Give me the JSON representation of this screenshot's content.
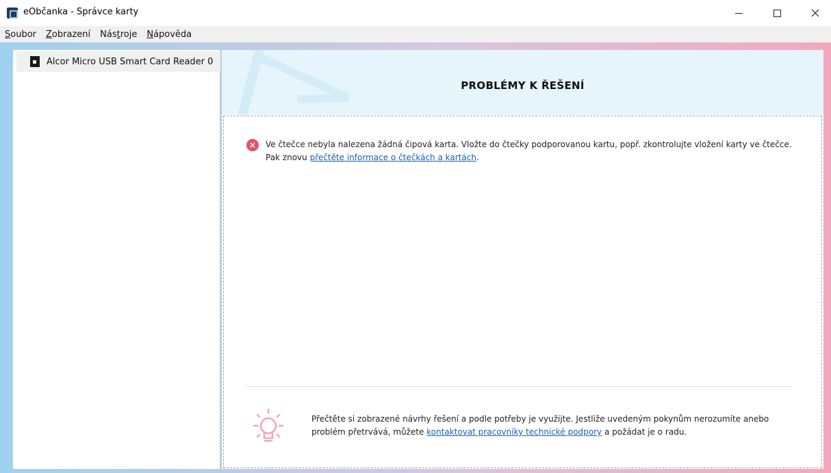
{
  "window": {
    "title": "eObčanka - Správce karty"
  },
  "menu": [
    {
      "label": "Soubor",
      "accel": "S",
      "rest": "oubor"
    },
    {
      "label": "Zobrazení",
      "accel": "Z",
      "rest": "obrazení"
    },
    {
      "label": "Nástroje",
      "pre": "Nás",
      "accel": "t",
      "rest": "roje"
    },
    {
      "label": "Nápověda",
      "accel": "N",
      "rest": "ápověda"
    }
  ],
  "sidebar": {
    "items": [
      {
        "label": "Alcor Micro USB Smart Card Reader 0",
        "icon": "card-reader-icon"
      }
    ]
  },
  "header": {
    "title": "PROBLÉMY K ŘEŠENÍ"
  },
  "error": {
    "icon": "error-icon",
    "text_before": "Ve čtečce nebyla nalezena žádná čipová karta. Vložte do čtečky podporovanou kartu, popř. zkontrolujte vložení karty ve čtečce. Pak znovu ",
    "link": "přečtěte informace o čtečkách a kartách",
    "text_after": "."
  },
  "tip": {
    "icon": "lightbulb-icon",
    "text_before": "Přečtěte si zobrazené návrhy řešení a podle potřeby je využijte. Jestliže uvedeným pokynům nerozumíte anebo problém přetrvává, můžete ",
    "link": "kontaktovat pracovníky technické podpory",
    "text_after": " a požádat je o radu."
  },
  "colors": {
    "accent_link": "#1a5fb4",
    "error_red": "#e2546c",
    "header_bg": "#e6f5fc",
    "tip_pink": "#f4a5b5"
  }
}
